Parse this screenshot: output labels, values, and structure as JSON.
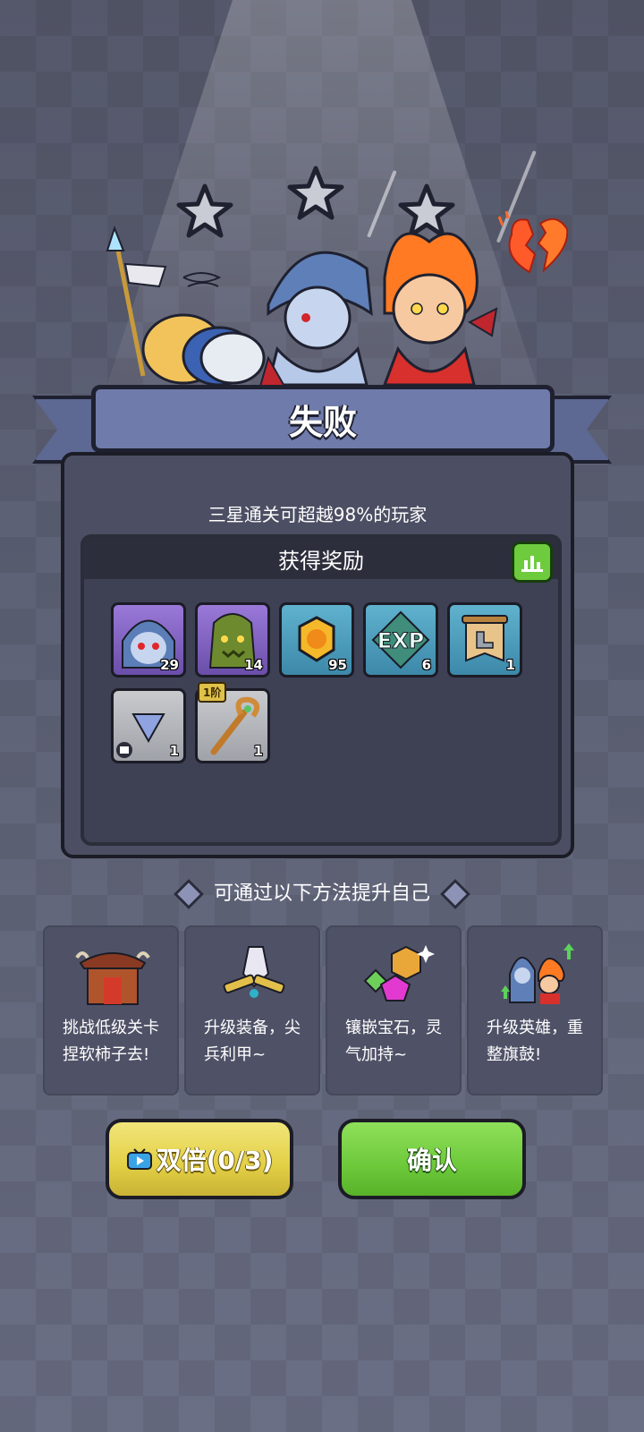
{
  "result": {
    "title": "失败",
    "stars_earned": 0,
    "stars_total": 3
  },
  "panel": {
    "subtitle": "三星通关可超越98%的玩家",
    "rewards_header": "获得奖励",
    "rewards": [
      {
        "icon": "hero-witch-shard",
        "count": "29",
        "rarity": "purple"
      },
      {
        "icon": "treant-shard",
        "count": "14",
        "rarity": "purple"
      },
      {
        "icon": "gold-coin",
        "count": "95",
        "rarity": "blue"
      },
      {
        "icon": "exp-token",
        "count": "6",
        "rarity": "blue"
      },
      {
        "icon": "scroll-boot",
        "count": "1",
        "rarity": "blue"
      },
      {
        "icon": "armor-gem",
        "count": "1",
        "rarity": "gray"
      },
      {
        "icon": "staff-weapon",
        "count": "1",
        "rarity": "gray",
        "tier": "1阶"
      }
    ]
  },
  "improve": {
    "title": "可通过以下方法提升自己",
    "tips": [
      {
        "icon": "gate-icon",
        "text": "挑战低级关卡捏软柿子去!"
      },
      {
        "icon": "equipment-icon",
        "text": "升级装备，尖兵利甲~"
      },
      {
        "icon": "gem-icon",
        "text": "镶嵌宝石，灵气加持~"
      },
      {
        "icon": "hero-upgrade-icon",
        "text": "升级英雄，重整旗鼓!"
      }
    ]
  },
  "buttons": {
    "double_label": "双倍(0/3)",
    "confirm_label": "确认"
  },
  "colors": {
    "confirm": "#6dc83a",
    "double": "#e2cf44",
    "banner": "#6f7bab"
  }
}
